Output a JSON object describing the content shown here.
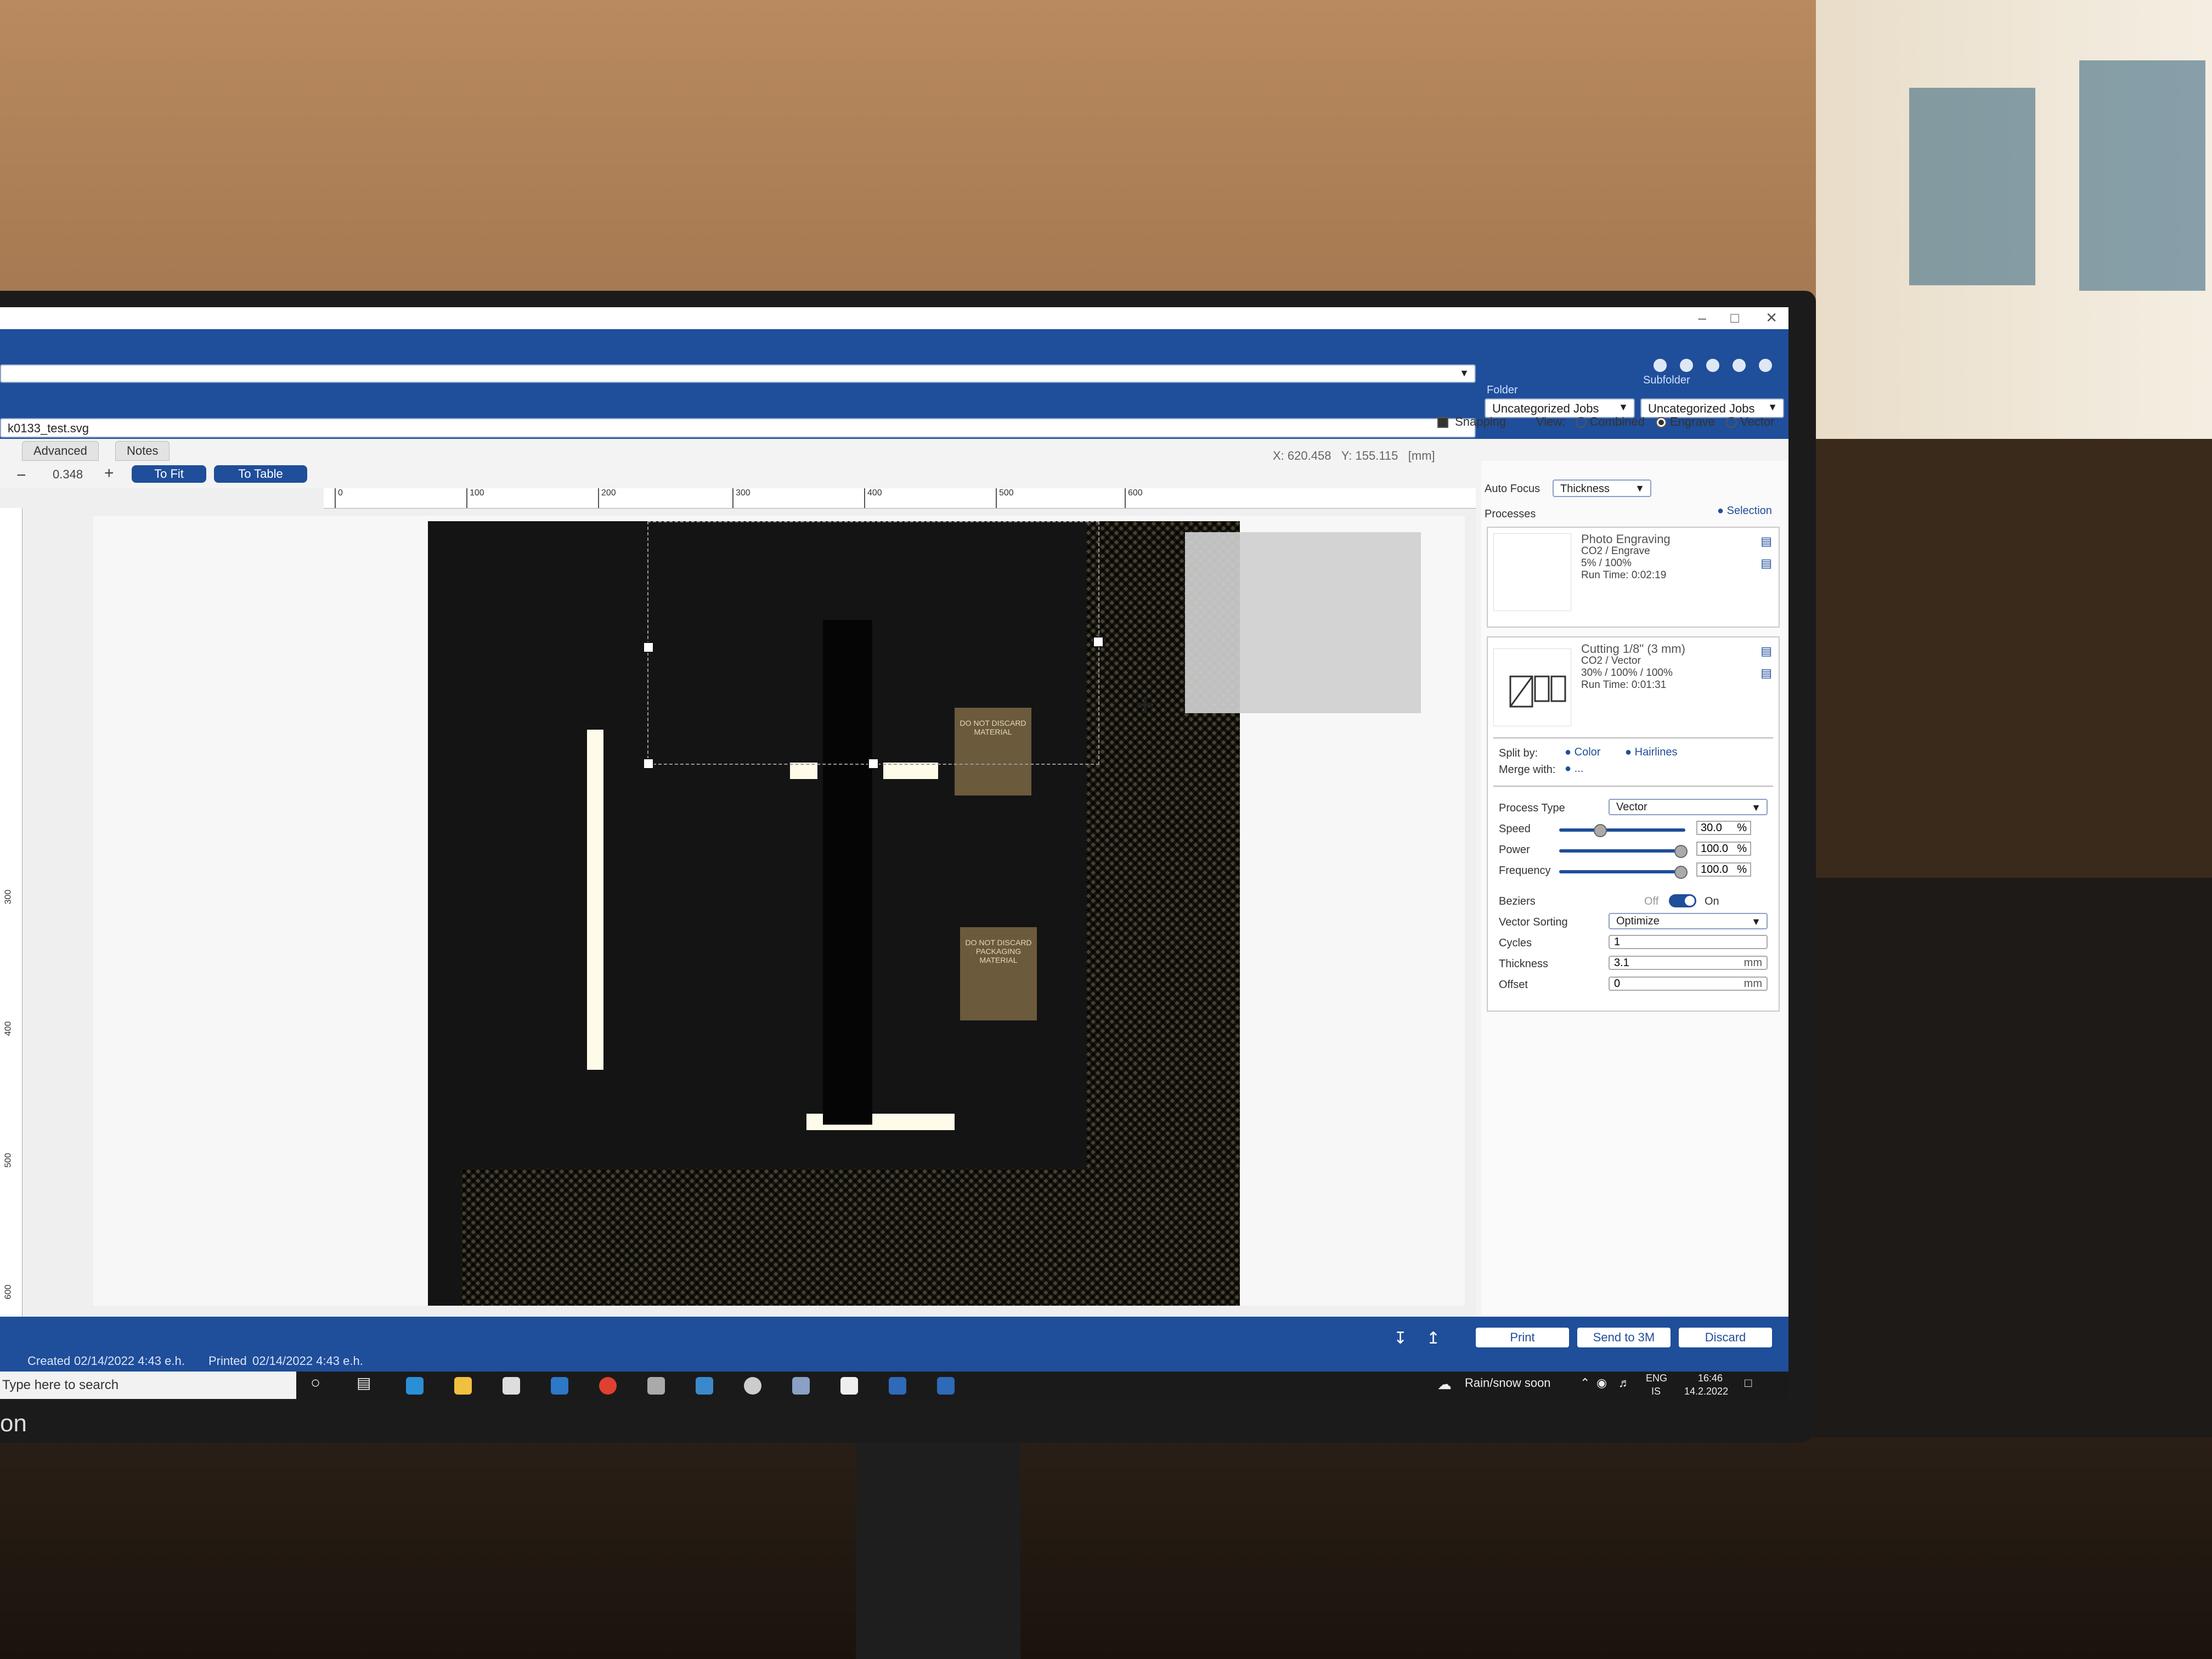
{
  "file": {
    "name": "k0133_test.svg"
  },
  "header": {
    "folder_label": "Folder",
    "subfolder_label": "Subfolder",
    "folder_value": "Uncategorized Jobs",
    "subfolder_value": "Uncategorized Jobs"
  },
  "tabs": [
    {
      "label": "Advanced"
    },
    {
      "label": "Notes"
    }
  ],
  "toolbar": {
    "zoom_value": "0.348",
    "to_fit": "To Fit",
    "to_table": "To Table"
  },
  "view": {
    "snapping": "Snapping",
    "view_label": "View:",
    "combined": "Combined",
    "engrave": "Engrave",
    "vector": "Vector"
  },
  "coords": {
    "x_label": "X:",
    "x_value": "620.458",
    "y_label": "Y:",
    "y_value": "155.115",
    "unit": "[mm]"
  },
  "ruler": {
    "h_ticks": [
      "0",
      "100",
      "200",
      "300",
      "400",
      "500",
      "600"
    ],
    "v_ticks": [
      "300",
      "400",
      "500",
      "600"
    ]
  },
  "panel": {
    "auto_focus_label": "Auto Focus",
    "auto_focus_value": "Thickness",
    "processes_label": "Processes",
    "selection_label": "Selection",
    "process1": {
      "title": "Photo Engraving",
      "line1": "CO2 / Engrave",
      "line2": "5% / 100%",
      "line3": "Run Time: 0:02:19"
    },
    "process2": {
      "title": "Cutting 1/8\" (3 mm)",
      "line1": "CO2 / Vector",
      "line2": "30% / 100% / 100%",
      "line3": "Run Time: 0:01:31"
    },
    "split_by": "Split by:",
    "merge_with": "Merge with:",
    "color": "Color",
    "hairlines": "Hairlines",
    "merge_value": "...",
    "process_type_label": "Process Type",
    "process_type_value": "Vector",
    "speed_label": "Speed",
    "speed_value": "30.0",
    "speed": 30,
    "power_label": "Power",
    "power_value": "100.0",
    "power": 100,
    "frequency_label": "Frequency",
    "frequency_value": "100.0",
    "frequency": 100,
    "percent": "%",
    "beziers_label": "Beziers",
    "off": "Off",
    "on": "On",
    "vector_sorting_label": "Vector Sorting",
    "vector_sorting_value": "Optimize",
    "cycles_label": "Cycles",
    "cycles_value": "1",
    "thickness_label": "Thickness",
    "thickness_value": "3.1",
    "offset_label": "Offset",
    "offset_value": "0",
    "mm": "mm"
  },
  "canvas_labels": {
    "sign1": "DO NOT DISCARD MATERIAL",
    "sign2": "DO NOT DISCARD PACKAGING MATERIAL"
  },
  "actions": {
    "print": "Print",
    "send": "Send to 3M",
    "discard": "Discard"
  },
  "status": {
    "created_label": "Created",
    "created_value": "02/14/2022 4:43 e.h.",
    "printed_label": "Printed",
    "printed_value": "02/14/2022 4:43 e.h."
  },
  "taskbar": {
    "search_placeholder": "Type here to search",
    "weather": "Rain/snow soon",
    "lang": "ENG",
    "lang2": "IS",
    "time": "16:46",
    "date": "14.2.2022"
  },
  "monitor_brand": "on",
  "colors": {
    "accent": "#1f4e9a"
  }
}
